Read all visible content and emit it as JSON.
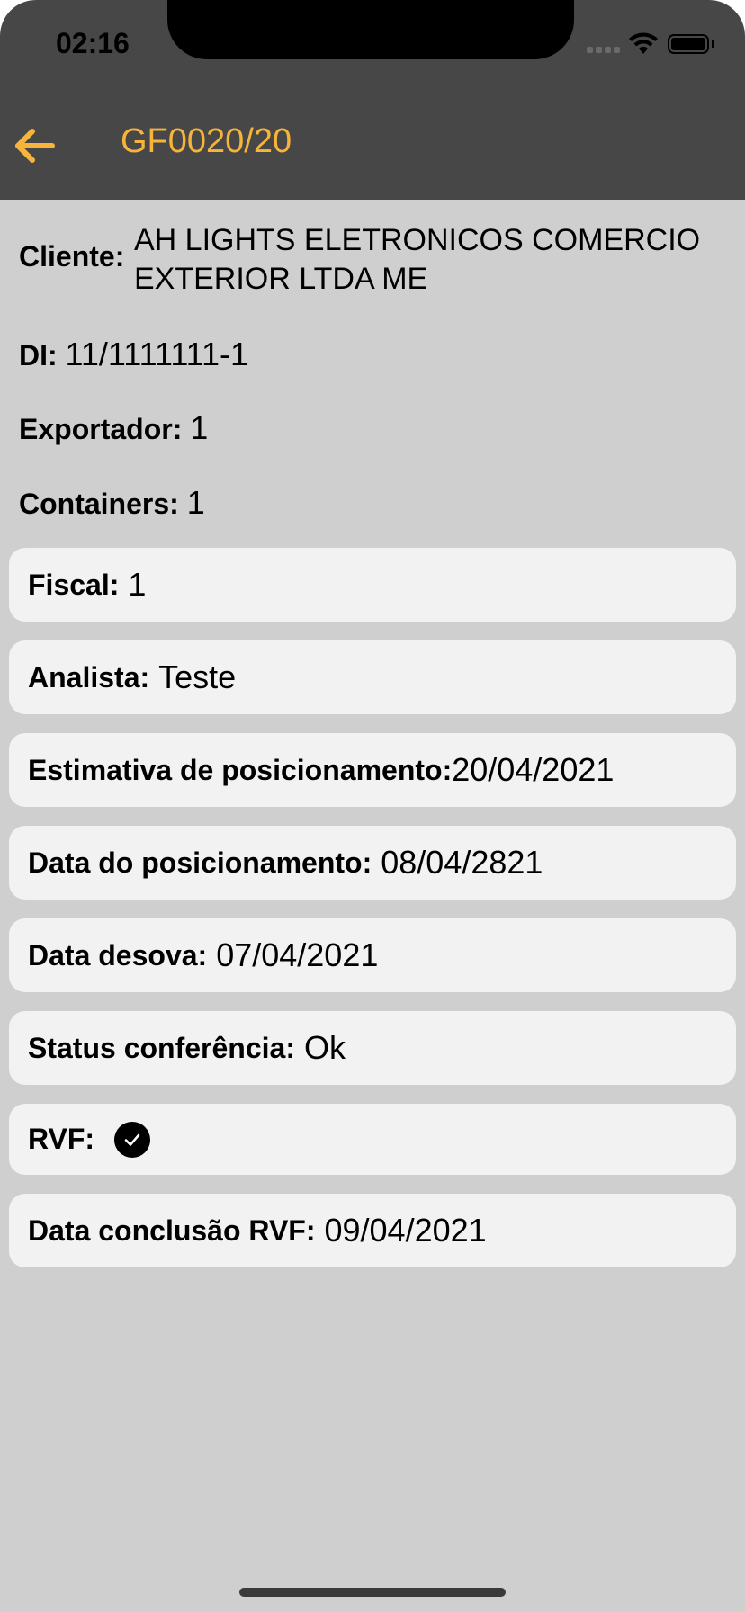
{
  "status_bar": {
    "time": "02:16"
  },
  "nav": {
    "title": "GF0020/20"
  },
  "header_info": {
    "client_label": "Cliente:",
    "client_value": "AH LIGHTS ELETRONICOS COMERCIO EXTERIOR LTDA ME",
    "di_label": "DI:",
    "di_value": "11/1111111-1",
    "exportador_label": "Exportador:",
    "exportador_value": "1",
    "containers_label": "Containers:",
    "containers_value": "1"
  },
  "cards": {
    "fiscal": {
      "label": "Fiscal:",
      "value": "1"
    },
    "analista": {
      "label": "Analista:",
      "value": "Teste"
    },
    "estimativa": {
      "label": "Estimativa de posicionamento:",
      "value": "20/04/2021"
    },
    "data_posicionamento": {
      "label": "Data do posicionamento:",
      "value": "08/04/2821"
    },
    "data_desova": {
      "label": "Data desova:",
      "value": "07/04/2021"
    },
    "status_conferencia": {
      "label": "Status conferência:",
      "value": "Ok"
    },
    "rvf": {
      "label": "RVF:",
      "checked": true
    },
    "data_conclusao_rvf": {
      "label": "Data conclusão RVF:",
      "value": "09/04/2021"
    }
  },
  "colors": {
    "accent": "#f6b53a",
    "header_bg": "#474747",
    "page_bg": "#cfcfcf",
    "card_bg": "#f2f2f2"
  },
  "icons": {
    "back": "arrow-left-icon",
    "rvf": "checkmark-circle-icon"
  }
}
